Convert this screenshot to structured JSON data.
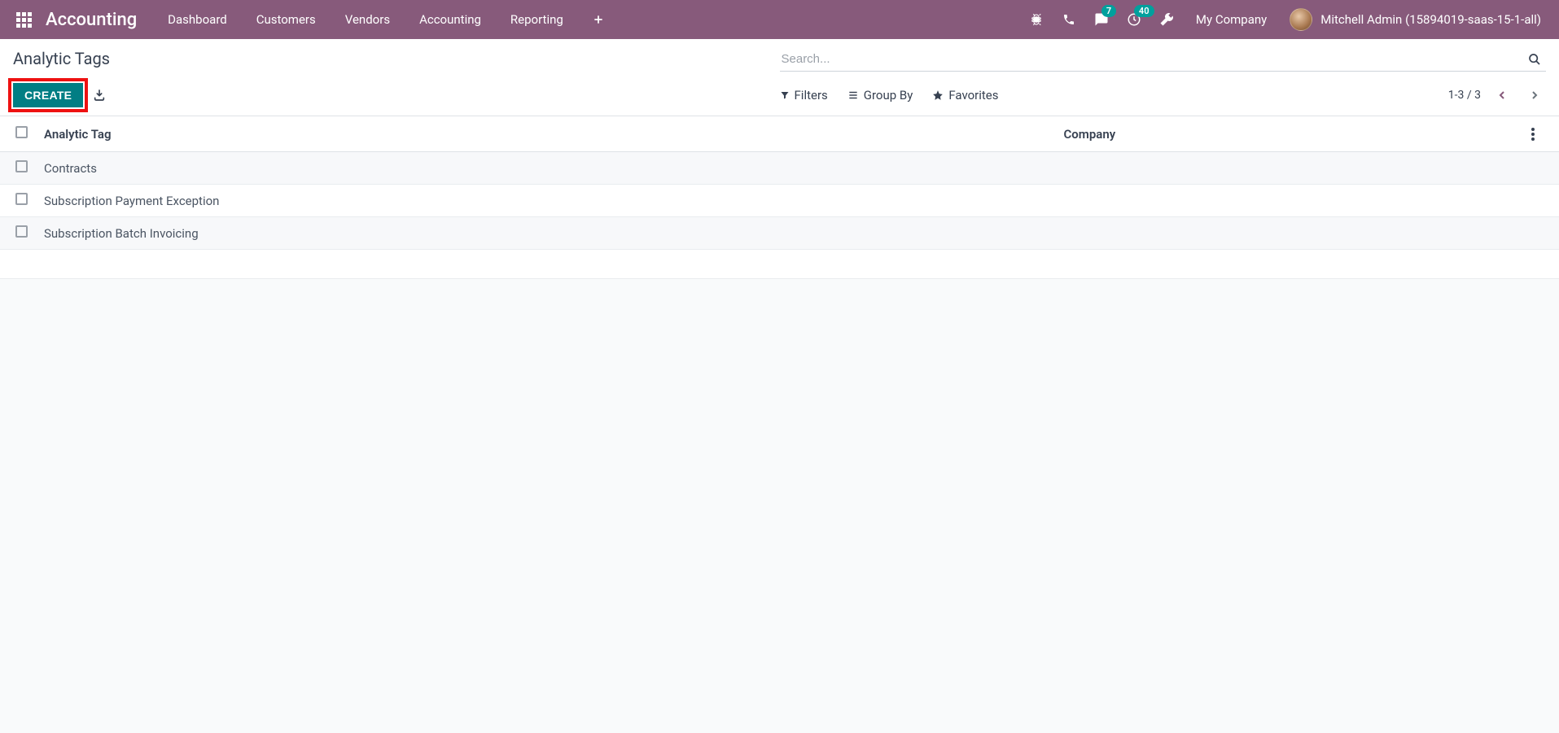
{
  "navbar": {
    "app_name": "Accounting",
    "menu": [
      "Dashboard",
      "Customers",
      "Vendors",
      "Accounting",
      "Reporting"
    ],
    "messages_badge": "7",
    "activities_badge": "40",
    "company": "My Company",
    "user": "Mitchell Admin (15894019-saas-15-1-all)"
  },
  "control_panel": {
    "breadcrumb": "Analytic Tags",
    "search_placeholder": "Search...",
    "create_label": "CREATE",
    "filters_label": "Filters",
    "groupby_label": "Group By",
    "favorites_label": "Favorites",
    "pager": "1-3 / 3"
  },
  "table": {
    "columns": {
      "tag": "Analytic Tag",
      "company": "Company"
    },
    "rows": [
      {
        "tag": "Contracts",
        "company": ""
      },
      {
        "tag": "Subscription Payment Exception",
        "company": ""
      },
      {
        "tag": "Subscription Batch Invoicing",
        "company": ""
      }
    ]
  }
}
